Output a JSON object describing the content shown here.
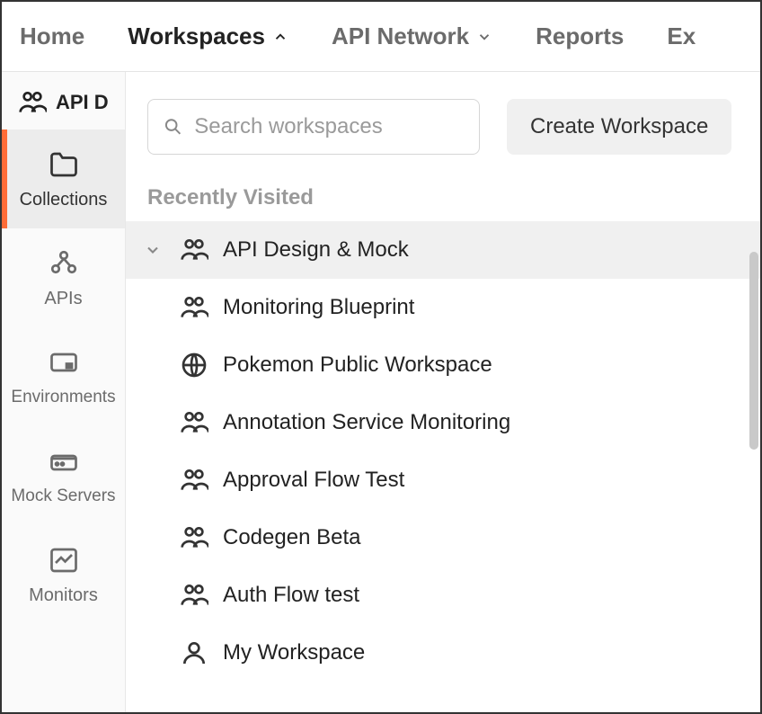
{
  "nav": {
    "home": "Home",
    "workspaces": "Workspaces",
    "api_network": "API Network",
    "reports": "Reports",
    "explore": "Ex"
  },
  "sidebar": {
    "workspace_name": "API D",
    "items": [
      {
        "label": "Collections"
      },
      {
        "label": "APIs"
      },
      {
        "label": "Environments"
      },
      {
        "label": "Mock Servers"
      },
      {
        "label": "Monitors"
      }
    ]
  },
  "dropdown": {
    "search_placeholder": "Search workspaces",
    "create_label": "Create Workspace",
    "section_label": "Recently Visited",
    "workspaces": [
      {
        "name": "API Design & Mock",
        "icon": "team",
        "expanded": true,
        "active": true
      },
      {
        "name": "Monitoring Blueprint",
        "icon": "team"
      },
      {
        "name": "Pokemon Public Workspace",
        "icon": "public"
      },
      {
        "name": "Annotation Service Monitoring",
        "icon": "team"
      },
      {
        "name": "Approval Flow Test",
        "icon": "team"
      },
      {
        "name": "Codegen Beta",
        "icon": "team"
      },
      {
        "name": "Auth Flow test",
        "icon": "team"
      },
      {
        "name": "My Workspace",
        "icon": "personal"
      }
    ]
  }
}
